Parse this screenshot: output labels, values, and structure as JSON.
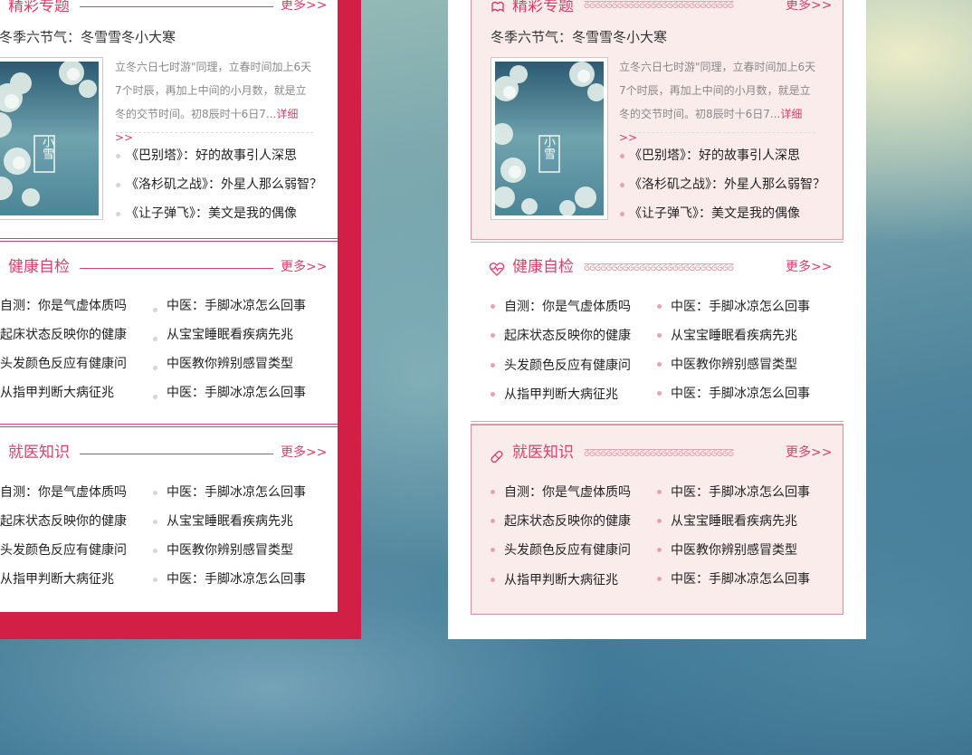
{
  "colors": {
    "accent": "#d7406a",
    "frame_red": "#d21f45",
    "pale_pink": "#fbecec"
  },
  "featured": {
    "heading": "精彩专题",
    "more": "更多>>",
    "subtitle": "冬季六节气：冬雪雪冬小大寒",
    "thumb_caption": "小雪",
    "summary": "立冬六日七时游\"同理，立春时间加上6天7个时辰，再加上中间的小月数，就是立冬的交节时间。初8辰时十6日7...",
    "detail_link": "详细>>",
    "items": [
      "《巴别塔》：好的故事引人深思",
      "《洛杉矶之战》：外星人那么弱智？",
      "《让子弹飞》：美文是我的偶像"
    ]
  },
  "health": {
    "heading": "健康自检",
    "more": "更多>>",
    "left_items": [
      "自测：你是气虚体质吗",
      "起床状态反映你的健康",
      "头发颜色反应有健康问",
      "从指甲判断大病征兆"
    ],
    "right_items": [
      "中医：手脚冰凉怎么回事",
      "从宝宝睡眠看疾病先兆",
      "中医教你辨别感冒类型",
      "中医：手脚冰凉怎么回事"
    ]
  },
  "medical": {
    "heading": "就医知识",
    "more": "更多>>",
    "left_items": [
      "自测：你是气虚体质吗",
      "起床状态反映你的健康",
      "头发颜色反应有健康问",
      "从指甲判断大病征兆"
    ],
    "right_items": [
      "中医：手脚冰凉怎么回事",
      "从宝宝睡眠看疾病先兆",
      "中医教你辨别感冒类型",
      "中医：手脚冰凉怎么回事"
    ]
  },
  "icons": {
    "featured": "book-icon",
    "health": "heart-pulse-icon",
    "medical": "pill-icon"
  }
}
